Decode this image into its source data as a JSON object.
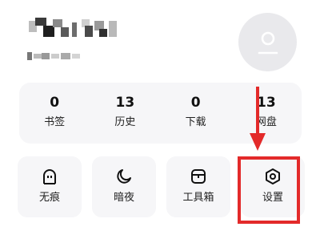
{
  "profile": {
    "avatar_icon": "user-icon"
  },
  "stats": [
    {
      "value": "0",
      "label": "书签"
    },
    {
      "value": "13",
      "label": "历史"
    },
    {
      "value": "0",
      "label": "下载"
    },
    {
      "value": "13",
      "label": "网盘"
    }
  ],
  "tools": [
    {
      "label": "无痕",
      "icon": "ghost-icon"
    },
    {
      "label": "暗夜",
      "icon": "moon-icon"
    },
    {
      "label": "工具箱",
      "icon": "toolbox-icon"
    },
    {
      "label": "设置",
      "icon": "settings-hexagon-icon"
    }
  ],
  "annotation": {
    "color": "#e32a2a"
  }
}
